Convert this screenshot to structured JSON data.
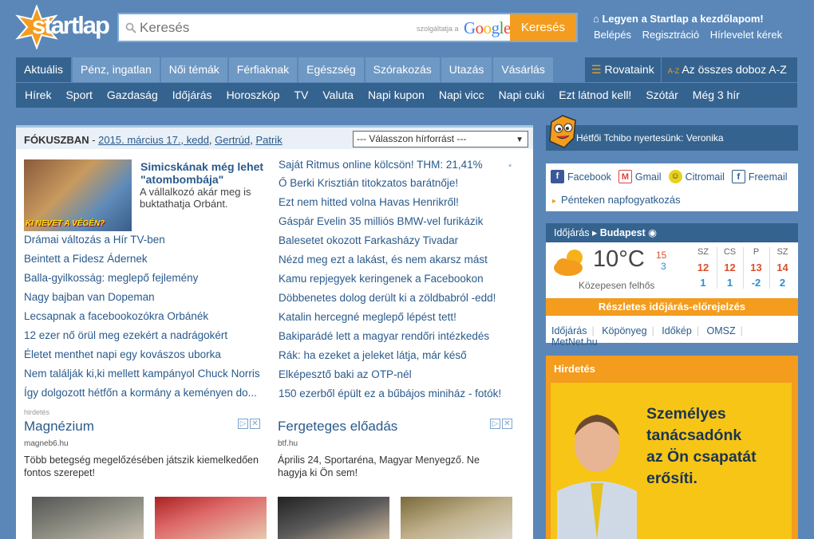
{
  "header": {
    "logo_text": "startlap",
    "search_placeholder": "Keresés",
    "powered_by": "szolgáltatja a",
    "google": "Google",
    "search_button": "Keresés",
    "homepage_link": "Legyen a Startlap a kezdőlapom!",
    "top_links": [
      "Belépés",
      "Regisztráció",
      "Hírlevelet kérek"
    ]
  },
  "nav": {
    "tabs": [
      "Aktuális",
      "Pénz, ingatlan",
      "Női témák",
      "Férfiaknak",
      "Egészség",
      "Szórakozás",
      "Utazás",
      "Vásárlás"
    ],
    "rovataink": "Rovataink",
    "az_badge": "A-Z",
    "az_label": "Az összes doboz A-Z",
    "subnav": [
      "Hírek",
      "Sport",
      "Gazdaság",
      "Időjárás",
      "Horoszkóp",
      "TV",
      "Valuta",
      "Napi kupon",
      "Napi vicc",
      "Napi cuki",
      "Ezt látnod kell!",
      "Szótár",
      "Még 3 hír"
    ]
  },
  "focus": {
    "label": "FÓKUSZBAN",
    "sep": " - ",
    "date": "2015. március 17., kedd",
    "name1": "Gertrúd",
    "name2": "Patrik",
    "select": "--- Válasszon hírforrást ---",
    "image_caption": "KI NEVET A VÉGÉN?",
    "featured_title": "Simicskának még lehet \"atombombája\"",
    "featured_desc": "A vállalkozó akár meg is buktathatja Orbánt.",
    "left": [
      "Drámai változás a Hír TV-ben",
      "Beintett a Fidesz Ádernek",
      "Balla-gyilkosság: meglepő fejlemény",
      "Nagy bajban van Dopeman",
      "Lecsapnak a facebookozókra Orbánék",
      "12 ezer nő örül meg ezekért a nadrágokért",
      "Életet menthet napi egy kovászos uborka",
      "Nem találják ki,ki mellett kampányol Chuck Norris",
      "Így dolgozott hétfőn a kormány a keményen do..."
    ],
    "right": [
      "Saját Ritmus online kölcsön! THM: 21,41%",
      "Ő Berki Krisztián titokzatos barátnője!",
      "Ezt nem hitted volna Havas Henrikről!",
      "Gáspár Evelin 35 milliós BMW-vel furikázik",
      "Balesetet okozott Farkasházy Tivadar",
      "Nézd meg ezt a lakást, és nem akarsz mást",
      "Kamu repjegyek keringenek a Facebookon",
      "Döbbenetes dolog derült ki a zöldbabról -edd!",
      "Katalin hercegné meglepő lépést tett!",
      "Bakiparádé lett a magyar rendőri intézkedés",
      "Rák: ha ezeket a jeleket látja, már késő",
      "Elképesztő baki az OTP-nél",
      "150 ezerből épült ez a bűbájos miniház - fotók!"
    ],
    "star": "*",
    "ad_label": "hirdetés",
    "ad1": {
      "title": "Magnézium",
      "url": "magneb6.hu",
      "desc": "Több betegség megelőzésében játszik kiemelkedően fontos szerepet!"
    },
    "ad2": {
      "title": "Fergeteges előadás",
      "url": "btf.hu",
      "desc": "Április 24, Sportaréna, Magyar Menyegző. Ne hagyja ki Ön sem!"
    }
  },
  "right": {
    "tchibo": "Hétfői Tchibo nyertesünk: Veronika",
    "social": [
      "Facebook",
      "Gmail",
      "Citromail",
      "Freemail"
    ],
    "eclipse": "Pénteken napfogyatkozás",
    "weather": {
      "label": "Időjárás",
      "city": "Budapest",
      "temp": "10°C",
      "hi": "15",
      "lo": "3",
      "desc": "Közepesen felhős",
      "forecast": [
        {
          "day": "SZ",
          "hi": "12",
          "lo": "1"
        },
        {
          "day": "CS",
          "hi": "12",
          "lo": "1"
        },
        {
          "day": "P",
          "hi": "13",
          "lo": "-2"
        },
        {
          "day": "SZ",
          "hi": "14",
          "lo": "2"
        }
      ],
      "detail": "Részletes időjárás-előrejelzés",
      "links": [
        "Időjárás",
        "Köpönyeg",
        "Időkép",
        "OMSZ",
        "MetNet.hu"
      ]
    },
    "ad_label": "Hirdetés",
    "banner_lines": [
      "Személyes",
      "tanácsadónk",
      "az Ön csapatát",
      "erősíti."
    ]
  }
}
